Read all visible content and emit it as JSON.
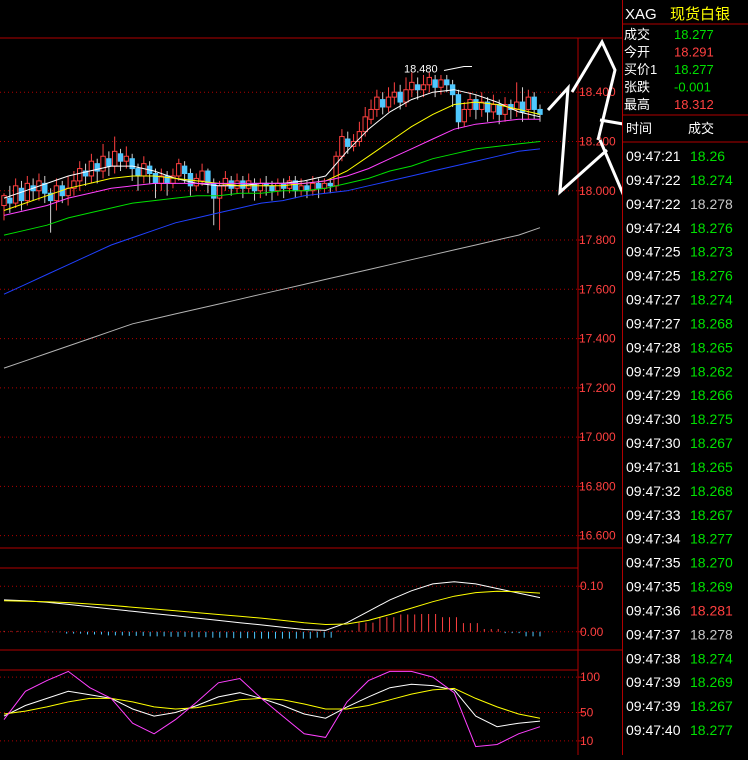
{
  "window": {
    "symbol": "XAG",
    "name": "现货白银"
  },
  "quote": {
    "rows": [
      {
        "label": "成交",
        "value": "18.277",
        "color": "#00e000"
      },
      {
        "label": "今开",
        "value": "18.291",
        "color": "#ff4040"
      },
      {
        "label": "买价1",
        "value": "18.277",
        "color": "#00e000"
      },
      {
        "label": "张跌",
        "value": "-0.001",
        "color": "#00e000"
      },
      {
        "label": "最高",
        "value": "18.312",
        "color": "#ff4040"
      }
    ]
  },
  "ticks": {
    "headers": [
      "时间",
      "成交"
    ],
    "rows": [
      {
        "time": "09:47:21",
        "price": "18.26",
        "dir": "down"
      },
      {
        "time": "09:47:22",
        "price": "18.274",
        "dir": "down"
      },
      {
        "time": "09:47:22",
        "price": "18.278",
        "dir": "flat"
      },
      {
        "time": "09:47:24",
        "price": "18.276",
        "dir": "down"
      },
      {
        "time": "09:47:25",
        "price": "18.273",
        "dir": "down"
      },
      {
        "time": "09:47:25",
        "price": "18.276",
        "dir": "down"
      },
      {
        "time": "09:47:27",
        "price": "18.274",
        "dir": "down"
      },
      {
        "time": "09:47:27",
        "price": "18.268",
        "dir": "down"
      },
      {
        "time": "09:47:28",
        "price": "18.265",
        "dir": "down"
      },
      {
        "time": "09:47:29",
        "price": "18.262",
        "dir": "down"
      },
      {
        "time": "09:47:29",
        "price": "18.266",
        "dir": "down"
      },
      {
        "time": "09:47:30",
        "price": "18.275",
        "dir": "down"
      },
      {
        "time": "09:47:30",
        "price": "18.267",
        "dir": "down"
      },
      {
        "time": "09:47:31",
        "price": "18.265",
        "dir": "down"
      },
      {
        "time": "09:47:32",
        "price": "18.268",
        "dir": "down"
      },
      {
        "time": "09:47:33",
        "price": "18.267",
        "dir": "down"
      },
      {
        "time": "09:47:34",
        "price": "18.277",
        "dir": "down"
      },
      {
        "time": "09:47:35",
        "price": "18.270",
        "dir": "down"
      },
      {
        "time": "09:47:35",
        "price": "18.269",
        "dir": "down"
      },
      {
        "time": "09:47:36",
        "price": "18.281",
        "dir": "up"
      },
      {
        "time": "09:47:37",
        "price": "18.278",
        "dir": "flat"
      },
      {
        "time": "09:47:38",
        "price": "18.274",
        "dir": "down"
      },
      {
        "time": "09:47:39",
        "price": "18.269",
        "dir": "down"
      },
      {
        "time": "09:47:39",
        "price": "18.267",
        "dir": "down"
      },
      {
        "time": "09:47:40",
        "price": "18.277",
        "dir": "down"
      }
    ]
  },
  "colors": {
    "up": "#ff4040",
    "down": "#00e000",
    "flat": "#c8c8c8",
    "grid": "#b00000",
    "axis": "#ff4040"
  },
  "chart_data": [
    {
      "type": "candlestick",
      "annotation": "18.480",
      "yticks": [
        "18.400",
        "18.200",
        "18.000",
        "17.800",
        "17.600",
        "17.400",
        "17.200",
        "17.000",
        "16.800",
        "16.600"
      ],
      "ylim": [
        16.55,
        18.62
      ],
      "candles": [
        [
          17.94,
          17.98,
          17.88,
          17.99
        ],
        [
          17.97,
          17.95,
          17.91,
          18.02
        ],
        [
          17.95,
          18.02,
          17.93,
          18.05
        ],
        [
          18.01,
          17.96,
          17.92,
          18.04
        ],
        [
          17.96,
          18.03,
          17.94,
          18.06
        ],
        [
          18.02,
          18.0,
          17.96,
          18.05
        ],
        [
          18.0,
          18.04,
          17.96,
          18.07
        ],
        [
          18.03,
          17.99,
          17.95,
          18.06
        ],
        [
          17.99,
          17.96,
          17.83,
          18.01
        ],
        [
          17.96,
          18.02,
          17.92,
          18.05
        ],
        [
          18.02,
          17.98,
          17.95,
          18.04
        ],
        [
          17.98,
          18.01,
          17.94,
          18.06
        ],
        [
          18.01,
          18.04,
          17.98,
          18.08
        ],
        [
          18.04,
          18.09,
          18.0,
          18.12
        ],
        [
          18.08,
          18.06,
          18.02,
          18.11
        ],
        [
          18.06,
          18.12,
          18.03,
          18.15
        ],
        [
          18.11,
          18.08,
          18.03,
          18.13
        ],
        [
          18.08,
          18.14,
          18.05,
          18.19
        ],
        [
          18.13,
          18.1,
          18.06,
          18.16
        ],
        [
          18.1,
          18.16,
          18.07,
          18.22
        ],
        [
          18.15,
          18.12,
          18.08,
          18.17
        ],
        [
          18.12,
          18.14,
          18.09,
          18.18
        ],
        [
          18.13,
          18.09,
          18.04,
          18.15
        ],
        [
          18.09,
          18.06,
          18.0,
          18.11
        ],
        [
          18.06,
          18.11,
          18.03,
          18.14
        ],
        [
          18.1,
          18.07,
          18.03,
          18.12
        ],
        [
          18.07,
          18.03,
          17.97,
          18.09
        ],
        [
          18.03,
          18.06,
          18.0,
          18.09
        ],
        [
          18.06,
          18.03,
          17.98,
          18.08
        ],
        [
          18.03,
          18.06,
          18.01,
          18.09
        ],
        [
          18.06,
          18.11,
          18.04,
          18.13
        ],
        [
          18.1,
          18.07,
          18.03,
          18.12
        ],
        [
          18.07,
          18.02,
          17.98,
          18.09
        ],
        [
          18.02,
          18.05,
          18.0,
          18.07
        ],
        [
          18.04,
          18.08,
          18.02,
          18.11
        ],
        [
          18.08,
          18.03,
          17.99,
          18.09
        ],
        [
          18.03,
          17.97,
          17.86,
          18.05
        ],
        [
          17.97,
          18.02,
          17.84,
          18.04
        ],
        [
          18.02,
          18.05,
          18.0,
          18.08
        ],
        [
          18.04,
          18.01,
          17.98,
          18.06
        ],
        [
          18.01,
          18.04,
          17.99,
          18.07
        ],
        [
          18.04,
          18.01,
          17.97,
          18.06
        ],
        [
          18.01,
          18.04,
          17.99,
          18.07
        ],
        [
          18.03,
          18.0,
          17.96,
          18.05
        ],
        [
          18.0,
          18.03,
          17.97,
          18.05
        ],
        [
          18.03,
          18.02,
          17.98,
          18.06
        ],
        [
          18.02,
          18.0,
          17.96,
          18.04
        ],
        [
          18.0,
          18.03,
          17.98,
          18.05
        ],
        [
          18.03,
          18.01,
          17.97,
          18.05
        ],
        [
          18.01,
          18.04,
          17.99,
          18.06
        ],
        [
          18.04,
          18.0,
          17.97,
          18.06
        ],
        [
          18.0,
          18.02,
          17.98,
          18.05
        ],
        [
          18.02,
          18.0,
          17.97,
          18.04
        ],
        [
          18.0,
          18.03,
          17.98,
          18.06
        ],
        [
          18.03,
          18.01,
          17.97,
          18.05
        ],
        [
          18.01,
          18.03,
          17.99,
          18.05
        ],
        [
          18.03,
          18.02,
          17.99,
          18.05
        ],
        [
          18.02,
          18.14,
          18.0,
          18.16
        ],
        [
          18.14,
          18.22,
          18.12,
          18.25
        ],
        [
          18.21,
          18.18,
          18.15,
          18.24
        ],
        [
          18.18,
          18.2,
          18.16,
          18.23
        ],
        [
          18.2,
          18.24,
          18.18,
          18.28
        ],
        [
          18.24,
          18.3,
          18.22,
          18.34
        ],
        [
          18.29,
          18.33,
          18.27,
          18.37
        ],
        [
          18.33,
          18.38,
          18.3,
          18.41
        ],
        [
          18.37,
          18.34,
          18.31,
          18.4
        ],
        [
          18.34,
          18.38,
          18.32,
          18.42
        ],
        [
          18.38,
          18.4,
          18.35,
          18.44
        ],
        [
          18.4,
          18.36,
          18.33,
          18.43
        ],
        [
          18.36,
          18.41,
          18.34,
          18.46
        ],
        [
          18.41,
          18.44,
          18.38,
          18.48
        ],
        [
          18.43,
          18.41,
          18.37,
          18.46
        ],
        [
          18.41,
          18.43,
          18.38,
          18.47
        ],
        [
          18.43,
          18.46,
          18.4,
          18.48
        ],
        [
          18.45,
          18.42,
          18.38,
          18.47
        ],
        [
          18.42,
          18.45,
          18.39,
          18.47
        ],
        [
          18.45,
          18.43,
          18.4,
          18.47
        ],
        [
          18.43,
          18.39,
          18.34,
          18.45
        ],
        [
          18.39,
          18.28,
          18.25,
          18.41
        ],
        [
          18.28,
          18.33,
          18.26,
          18.36
        ],
        [
          18.33,
          18.37,
          18.3,
          18.4
        ],
        [
          18.37,
          18.33,
          18.29,
          18.39
        ],
        [
          18.33,
          18.36,
          18.3,
          18.4
        ],
        [
          18.36,
          18.32,
          18.28,
          18.38
        ],
        [
          18.32,
          18.35,
          18.29,
          18.39
        ],
        [
          18.35,
          18.31,
          18.27,
          18.37
        ],
        [
          18.31,
          18.35,
          18.28,
          18.38
        ],
        [
          18.35,
          18.33,
          18.29,
          18.37
        ],
        [
          18.33,
          18.36,
          18.3,
          18.44
        ],
        [
          18.36,
          18.32,
          18.28,
          18.42
        ],
        [
          18.33,
          18.38,
          18.29,
          18.41
        ],
        [
          18.38,
          18.33,
          18.29,
          18.4
        ],
        [
          18.33,
          18.31,
          18.28,
          18.35
        ]
      ],
      "ma": [
        {
          "color": "#ffffff",
          "values": [
            17.97,
            18.0,
            18.03,
            18.06,
            18.08,
            18.1,
            18.1,
            18.08,
            18.05,
            18.03,
            18.02,
            18.02,
            18.03,
            18.03,
            18.04,
            18.06,
            18.16,
            18.25,
            18.32,
            18.37,
            18.4,
            18.41,
            18.39,
            18.36,
            18.32,
            18.3
          ]
        },
        {
          "color": "#ffff00",
          "values": [
            17.92,
            17.95,
            17.98,
            18.01,
            18.03,
            18.05,
            18.06,
            18.06,
            18.05,
            18.04,
            18.03,
            18.02,
            18.02,
            18.02,
            18.03,
            18.04,
            18.08,
            18.14,
            18.2,
            18.26,
            18.31,
            18.35,
            18.36,
            18.35,
            18.33,
            18.31
          ]
        },
        {
          "color": "#ff40ff",
          "values": [
            17.9,
            17.92,
            17.94,
            17.97,
            17.99,
            18.01,
            18.02,
            18.03,
            18.03,
            18.03,
            18.03,
            18.03,
            18.03,
            18.03,
            18.03,
            18.04,
            18.06,
            18.09,
            18.13,
            18.17,
            18.21,
            18.25,
            18.27,
            18.28,
            18.29,
            18.29
          ]
        },
        {
          "color": "#00e000",
          "values": [
            17.82,
            17.84,
            17.86,
            17.89,
            17.91,
            17.93,
            17.95,
            17.96,
            17.97,
            17.98,
            17.98,
            17.99,
            17.99,
            18.0,
            18.0,
            18.01,
            18.03,
            18.05,
            18.08,
            18.1,
            18.13,
            18.15,
            18.17,
            18.18,
            18.19,
            18.2
          ]
        },
        {
          "color": "#2040ff",
          "values": [
            17.58,
            17.62,
            17.66,
            17.7,
            17.74,
            17.78,
            17.81,
            17.84,
            17.87,
            17.89,
            17.91,
            17.93,
            17.95,
            17.96,
            17.98,
            17.99,
            18.0,
            18.02,
            18.04,
            18.06,
            18.08,
            18.1,
            18.12,
            18.14,
            18.16,
            18.17
          ]
        },
        {
          "color": "#b4b4b4",
          "values": [
            17.28,
            17.31,
            17.34,
            17.37,
            17.4,
            17.43,
            17.46,
            17.48,
            17.5,
            17.52,
            17.54,
            17.56,
            17.58,
            17.6,
            17.62,
            17.64,
            17.66,
            17.68,
            17.7,
            17.72,
            17.74,
            17.76,
            17.78,
            17.8,
            17.82,
            17.85
          ]
        }
      ]
    },
    {
      "type": "macd",
      "yticks": [
        "0.10",
        "0.00"
      ],
      "ylim": [
        -0.04,
        0.14
      ],
      "dif": [
        0.07,
        0.068,
        0.065,
        0.06,
        0.055,
        0.05,
        0.045,
        0.04,
        0.035,
        0.03,
        0.025,
        0.02,
        0.015,
        0.01,
        0.005,
        0.003,
        0.02,
        0.045,
        0.07,
        0.09,
        0.105,
        0.11,
        0.105,
        0.095,
        0.085,
        0.075
      ],
      "dea": [
        0.068,
        0.067,
        0.066,
        0.064,
        0.061,
        0.058,
        0.054,
        0.05,
        0.046,
        0.042,
        0.038,
        0.034,
        0.03,
        0.025,
        0.02,
        0.016,
        0.017,
        0.025,
        0.038,
        0.052,
        0.066,
        0.078,
        0.086,
        0.089,
        0.088,
        0.085
      ],
      "hist": [
        0.002,
        0.001,
        -0.001,
        -0.004,
        -0.006,
        -0.008,
        -0.009,
        -0.01,
        -0.011,
        -0.012,
        -0.013,
        -0.014,
        -0.015,
        -0.015,
        -0.015,
        -0.013,
        0.003,
        0.02,
        0.032,
        0.038,
        0.039,
        0.032,
        0.019,
        0.006,
        -0.003,
        -0.01
      ]
    },
    {
      "type": "kdj",
      "yticks": [
        "100",
        "50",
        "10"
      ],
      "ylim": [
        0,
        110
      ],
      "k": [
        45,
        60,
        70,
        80,
        75,
        70,
        55,
        45,
        50,
        60,
        72,
        78,
        70,
        60,
        48,
        42,
        58,
        72,
        85,
        90,
        88,
        82,
        45,
        30,
        35,
        38
      ],
      "d": [
        48,
        52,
        58,
        65,
        70,
        70,
        65,
        58,
        55,
        57,
        62,
        68,
        70,
        68,
        62,
        55,
        55,
        60,
        68,
        76,
        82,
        84,
        70,
        58,
        48,
        42
      ],
      "j": [
        40,
        80,
        95,
        110,
        85,
        70,
        35,
        20,
        40,
        65,
        92,
        98,
        70,
        45,
        20,
        15,
        65,
        95,
        115,
        118,
        100,
        78,
        0,
        5,
        20,
        30
      ]
    }
  ]
}
